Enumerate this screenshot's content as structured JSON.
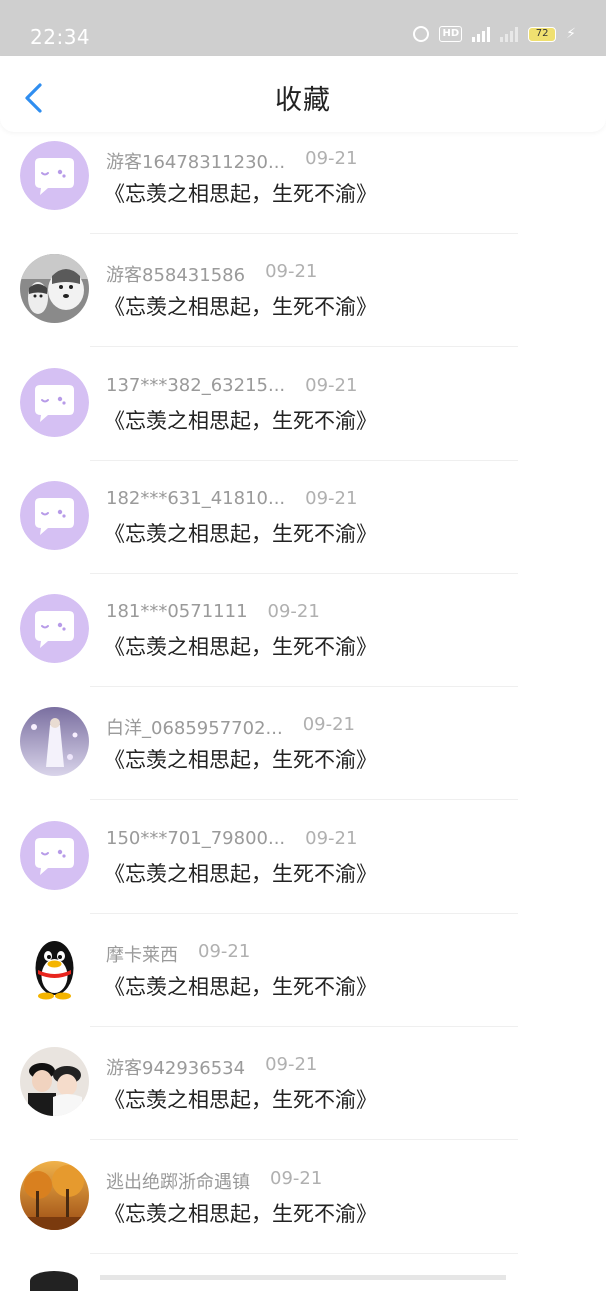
{
  "status_bar": {
    "time": "22:34",
    "hd": "HD",
    "battery": "72"
  },
  "header": {
    "title": "收藏"
  },
  "items": [
    {
      "user": "游客16478311230...",
      "date": "09-21",
      "title": "《忘羡之相思起，生死不渝》",
      "avatar": "default-chat-avatar"
    },
    {
      "user": "游客858431586",
      "date": "09-21",
      "title": "《忘羡之相思起，生死不渝》",
      "avatar": "husky-dog-avatar"
    },
    {
      "user": "137***382_63215...",
      "date": "09-21",
      "title": "《忘羡之相思起，生死不渝》",
      "avatar": "default-chat-avatar"
    },
    {
      "user": "182***631_41810...",
      "date": "09-21",
      "title": "《忘羡之相思起，生死不渝》",
      "avatar": "default-chat-avatar"
    },
    {
      "user": "181***0571111",
      "date": "09-21",
      "title": "《忘羡之相思起，生死不渝》",
      "avatar": "default-chat-avatar"
    },
    {
      "user": "白洋_0685957702...",
      "date": "09-21",
      "title": "《忘羡之相思起，生死不渝》",
      "avatar": "white-dress-avatar"
    },
    {
      "user": "150***701_79800...",
      "date": "09-21",
      "title": "《忘羡之相思起，生死不渝》",
      "avatar": "default-chat-avatar"
    },
    {
      "user": "摩卡莱西",
      "date": "09-21",
      "title": "《忘羡之相思起，生死不渝》",
      "avatar": "penguin-avatar"
    },
    {
      "user": "游客942936534",
      "date": "09-21",
      "title": "《忘羡之相思起，生死不渝》",
      "avatar": "couple-photo-avatar"
    },
    {
      "user": "逃出绝踯浙命遇镇",
      "date": "09-21",
      "title": "《忘羡之相思起，生死不渝》",
      "avatar": "autumn-trees-avatar"
    }
  ],
  "colors": {
    "accent": "#2f8ef0",
    "avatar_default_bg": "#d5c0f3",
    "title_text": "#222222",
    "meta_text": "#9a9a9a"
  }
}
